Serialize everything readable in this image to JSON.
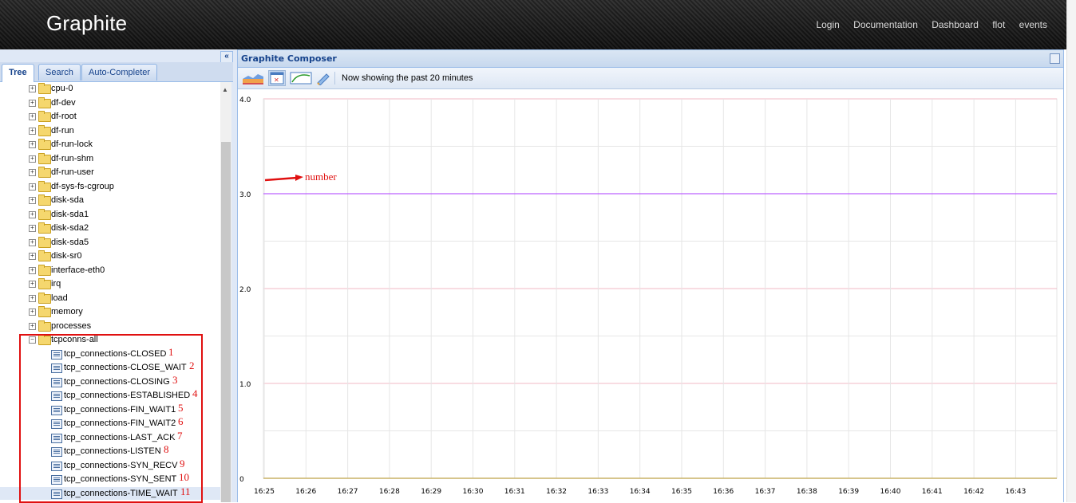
{
  "app": {
    "title": "Graphite"
  },
  "nav": [
    "Login",
    "Documentation",
    "Dashboard",
    "flot",
    "events"
  ],
  "left_panel": {
    "collapse_glyph": "«",
    "tabs": [
      "Tree",
      "Search",
      "Auto-Completer"
    ],
    "active_tab": "Tree"
  },
  "tree": {
    "folders": [
      "cpu-0",
      "df-dev",
      "df-root",
      "df-run",
      "df-run-lock",
      "df-run-shm",
      "df-run-user",
      "df-sys-fs-cgroup",
      "disk-sda",
      "disk-sda1",
      "disk-sda2",
      "disk-sda5",
      "disk-sr0",
      "interface-eth0",
      "irq",
      "load",
      "memory",
      "processes"
    ],
    "expanded_folder": "tcpconns-all",
    "metrics": [
      {
        "label": "tcp_connections-CLOSED",
        "annotation": "1"
      },
      {
        "label": "tcp_connections-CLOSE_WAIT",
        "annotation": "2"
      },
      {
        "label": "tcp_connections-CLOSING",
        "annotation": "3"
      },
      {
        "label": "tcp_connections-ESTABLISHED",
        "annotation": "4"
      },
      {
        "label": "tcp_connections-FIN_WAIT1",
        "annotation": "5"
      },
      {
        "label": "tcp_connections-FIN_WAIT2",
        "annotation": "6"
      },
      {
        "label": "tcp_connections-LAST_ACK",
        "annotation": "7"
      },
      {
        "label": "tcp_connections-LISTEN",
        "annotation": "8"
      },
      {
        "label": "tcp_connections-SYN_RECV",
        "annotation": "9"
      },
      {
        "label": "tcp_connections-SYN_SENT",
        "annotation": "10"
      },
      {
        "label": "tcp_connections-TIME_WAIT",
        "annotation": "11"
      }
    ],
    "selected_metric": "tcp_connections-TIME_WAIT"
  },
  "composer": {
    "title": "Graphite Composer",
    "time_status": "Now showing the past 20 minutes",
    "toolbar_icons": [
      "dashboard-icon",
      "time-range-icon",
      "graph-options-icon",
      "edit-icon"
    ]
  },
  "annotation": {
    "text": "number",
    "color": "#e01010"
  },
  "chart_data": {
    "type": "line",
    "x": [
      "16:25",
      "16:26",
      "16:27",
      "16:28",
      "16:29",
      "16:30",
      "16:31",
      "16:32",
      "16:33",
      "16:34",
      "16:35",
      "16:36",
      "16:37",
      "16:38",
      "16:39",
      "16:40",
      "16:41",
      "16:42",
      "16:43"
    ],
    "y_ticks": [
      "0",
      "1.0",
      "2.0",
      "3.0",
      "4.0"
    ],
    "ylim": [
      0,
      4
    ],
    "series": [
      {
        "color": "#c77dff",
        "values": [
          3,
          3,
          3,
          3,
          3,
          3,
          3,
          3,
          3,
          3,
          3,
          3,
          3,
          3,
          3,
          3,
          3,
          3,
          3
        ]
      }
    ],
    "baseline_color": "#c8b266",
    "grid": true
  }
}
